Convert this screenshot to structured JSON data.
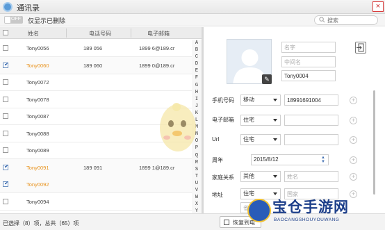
{
  "window": {
    "title": "通讯录",
    "close_glyph": "×"
  },
  "toolbar": {
    "toggle_text": "OFF",
    "toggle_label": "仅显示已删除",
    "search_placeholder": "搜索"
  },
  "list": {
    "headers": {
      "name": "姓名",
      "phone": "电话号码",
      "email": "电子邮箱"
    },
    "header_checkbox_checked": false,
    "rows": [
      {
        "name": "Tony0056",
        "phone": "189      056",
        "email": "1899      6@189.cr",
        "checked": false
      },
      {
        "name": "Tony0060",
        "phone": "189      060",
        "email": "1899      0@189.cr",
        "checked": true
      },
      {
        "name": "Tony0072",
        "phone": "",
        "email": "",
        "checked": false
      },
      {
        "name": "Tony0078",
        "phone": "",
        "email": "",
        "checked": false
      },
      {
        "name": "Tony0087",
        "phone": "",
        "email": "",
        "checked": false
      },
      {
        "name": "Tony0088",
        "phone": "",
        "email": "",
        "checked": false
      },
      {
        "name": "Tony0089",
        "phone": "",
        "email": "",
        "checked": false
      },
      {
        "name": "Tony0091",
        "phone": "189      091",
        "email": "1899      1@189.cr",
        "checked": true
      },
      {
        "name": "Tony0092",
        "phone": "",
        "email": "",
        "checked": true
      },
      {
        "name": "Tony0094",
        "phone": "",
        "email": "",
        "checked": false
      }
    ],
    "alphabet": [
      "A",
      "B",
      "C",
      "D",
      "E",
      "F",
      "G",
      "H",
      "I",
      "J",
      "K",
      "L",
      "M",
      "N",
      "O",
      "P",
      "Q",
      "R",
      "S",
      "T",
      "U",
      "V",
      "W",
      "X",
      "Y",
      "Z",
      "#"
    ]
  },
  "detail": {
    "first_name_placeholder": "名字",
    "middle_name_placeholder": "中间名",
    "last_name_value": "Tony0004",
    "phone_label": "手机号码",
    "phone_type": "移动",
    "phone_value": "18991691004",
    "email_label": "电子邮箱",
    "email_type": "住宅",
    "url_label": "Url",
    "url_type": "住宅",
    "anniversary_label": "周年",
    "anniversary_value": "2015/8/12",
    "relation_label": "家庭关系",
    "relation_type": "其他",
    "relation_placeholder": "姓名",
    "address_label": "地址",
    "address_type": "住宅",
    "address_placeholder": "国家",
    "address_placeholder_2": "省"
  },
  "status": {
    "text": "已选择（8）项，总共（65）项",
    "restore_label": "恢复到电"
  },
  "watermark": {
    "title": "宝仓手游网",
    "subtitle": "BAOCANGSHOUYOUWANG"
  },
  "colors": {
    "accent_orange": "#e8921c",
    "brand_blue": "#1d3f8a",
    "close_red": "#d93b3b"
  }
}
